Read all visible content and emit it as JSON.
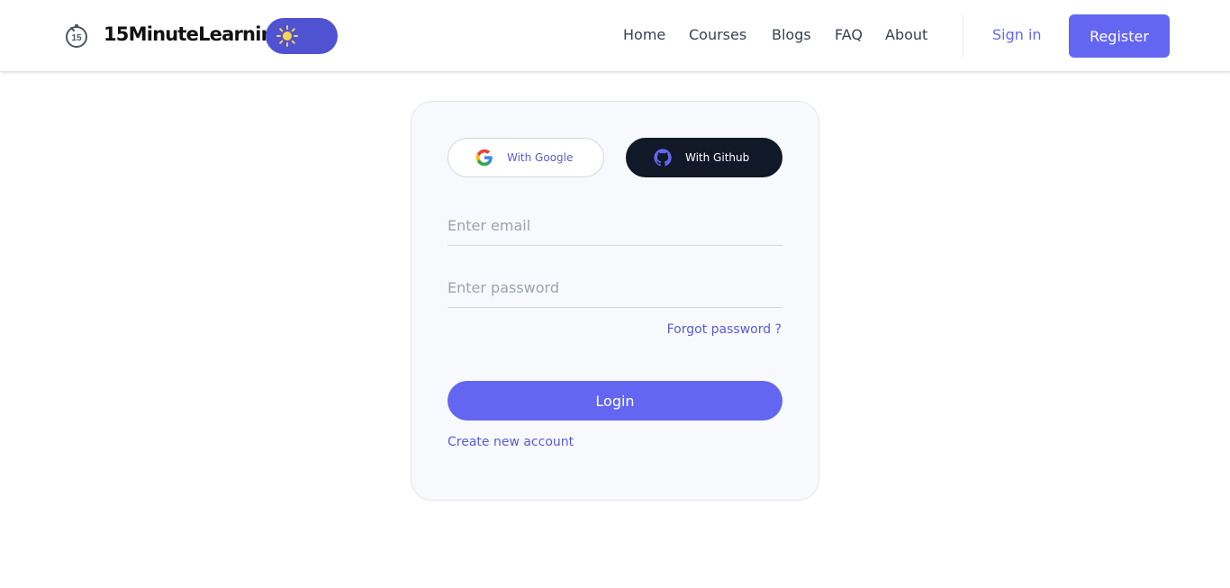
{
  "header": {
    "brand": "15MinuteLearning",
    "logo_icon": "stopwatch-15-icon",
    "theme_toggle_icon": "sun-icon",
    "nav": {
      "home": "Home",
      "courses": "Courses",
      "blogs": "Blogs",
      "faq": "FAQ",
      "about": "About"
    },
    "signin": "Sign in",
    "register": "Register"
  },
  "login": {
    "google_label": "With Google",
    "github_label": "With Github",
    "email_placeholder": "Enter email",
    "password_placeholder": "Enter password",
    "forgot": "Forgot password ?",
    "submit": "Login",
    "create_account": "Create new account"
  },
  "colors": {
    "accent": "#6366f1",
    "toggle": "#4f52d1",
    "github_button": "#111827",
    "link": "#5b5bd6"
  }
}
